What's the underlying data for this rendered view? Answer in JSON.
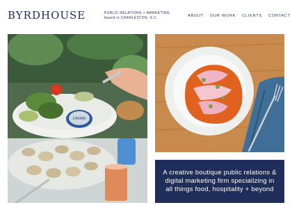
{
  "brand": {
    "logo_text_1": "BYRD",
    "logo_text_2": "OUSE",
    "logo_h": "H"
  },
  "tagline": {
    "line1": "PUBLIC RELATIONS + MARKETING",
    "line2": "based in CHARLESTON, S.C."
  },
  "nav": {
    "items": [
      "ABOUT",
      "OUR WORK",
      "CLIENTS",
      "CONTACT"
    ]
  },
  "caviar_tin_label": "CAVIAR",
  "info": {
    "text": "A creative boutique public relations & digital marketing firm specializing in all things food, hospitality + beyond"
  },
  "colors": {
    "navy": "#1e2d5a",
    "brand_text": "#1f2d52",
    "wood": "#c98a4e",
    "denim": "#3f6f96",
    "orange_sauce": "#e0621e"
  }
}
